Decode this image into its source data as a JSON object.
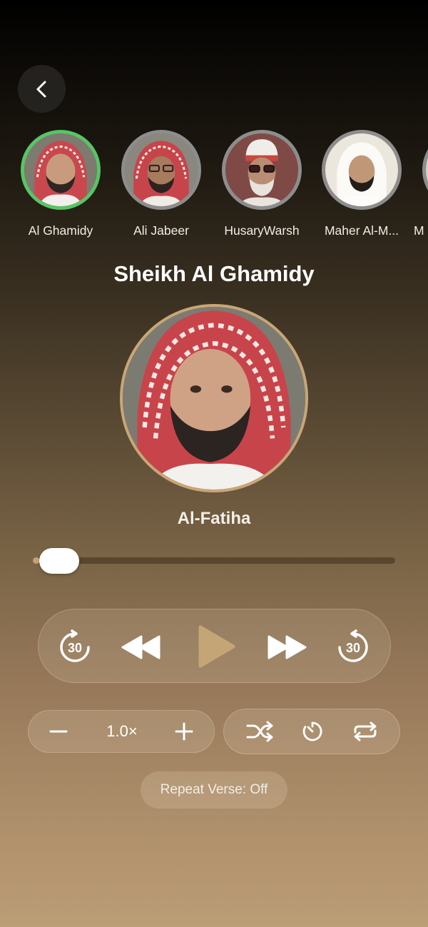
{
  "nav": {
    "back_icon": "chevron-left-icon"
  },
  "reciters": [
    {
      "name": "Al Ghamidy",
      "selected": true
    },
    {
      "name": "Ali Jabeer",
      "selected": false
    },
    {
      "name": "HusaryWarsh",
      "selected": false
    },
    {
      "name": "Maher Al-M...",
      "selected": false
    },
    {
      "name": "M",
      "selected": false
    }
  ],
  "player": {
    "title": "Sheikh Al Ghamidy",
    "surah": "Al-Fatiha",
    "progress": 0.02,
    "rewind_seconds": "30",
    "forward_seconds": "30"
  },
  "controls": {
    "speed": "1.0×",
    "repeat_verse": "Repeat Verse: Off"
  },
  "colors": {
    "selected_ring": "#58c466",
    "accent_gold": "#c7a373",
    "play_color": "#c4a676"
  }
}
